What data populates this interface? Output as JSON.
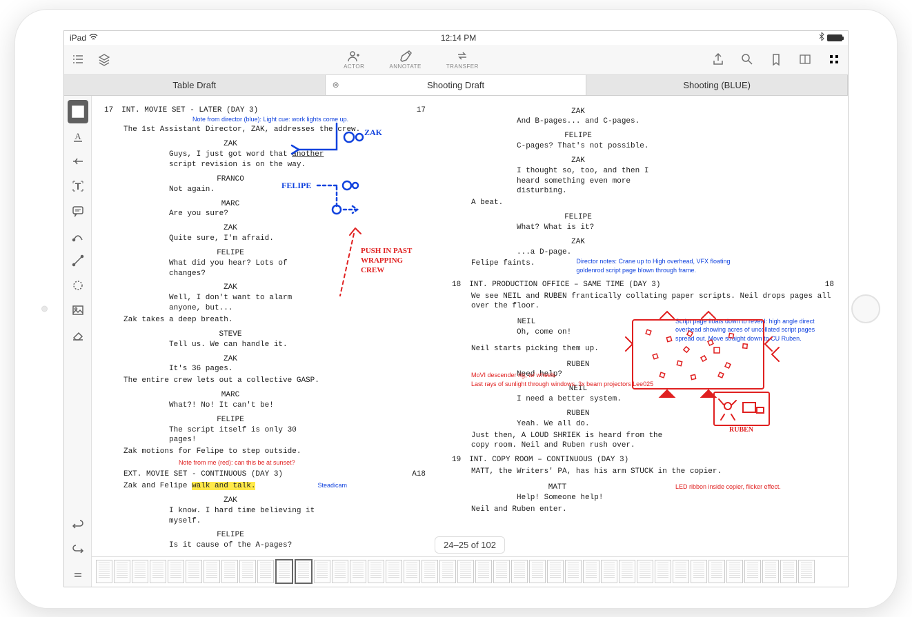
{
  "statusBar": {
    "device": "iPad",
    "time": "12:14 PM"
  },
  "toolbar": {
    "center": {
      "actor": "ACTOR",
      "annotate": "ANNOTATE",
      "transfer": "TRANSFER"
    }
  },
  "tabs": [
    {
      "label": "Table Draft",
      "active": false
    },
    {
      "label": "Shooting Draft",
      "active": true,
      "closable": true
    },
    {
      "label": "Shooting (BLUE)",
      "active": false
    }
  ],
  "pageIndicator": "24–25 of 102",
  "leftPage": {
    "sceneNum": "17",
    "sceneNumRight": "17",
    "sceneARight": "A18",
    "slug1": "INT. MOVIE SET - LATER (DAY 3)",
    "noteBlue1": "Note from director (blue): Light cue: work lights come up.",
    "action1": "The 1st Assistant Director, ZAK, addresses the crew.",
    "char1": "ZAK",
    "d1a": "Guys, I just got word that ",
    "d1u": "another",
    "d1b": "script revision is on the way.",
    "char2": "FRANCO",
    "d2": "Not again.",
    "char3": "MARC",
    "d3": "Are you sure?",
    "char4": "ZAK",
    "d4": "Quite sure, I'm afraid.",
    "char5": "FELIPE",
    "d5": "What did you hear? Lots of changes?",
    "char6": "ZAK",
    "d6": "Well, I don't want to alarm anyone, but...",
    "action2": "Zak takes a deep breath.",
    "char7": "STEVE",
    "d7": "Tell us. We can handle it.",
    "char8": "ZAK",
    "d8": "It's 36 pages.",
    "action3": "The entire crew lets out a collective GASP.",
    "char9": "MARC",
    "d9": "What?! No! It can't be!",
    "char10": "FELIPE",
    "d10": "The script itself is only 30 pages!",
    "action4": "Zak motions for Felipe to step outside.",
    "noteRed1": "Note from me (red): can this be at sunset?",
    "slug2": "EXT. MOVIE SET - CONTINUOUS (DAY 3)",
    "action5a": "Zak and Felipe ",
    "action5h": "walk and talk.",
    "noteBlue2": "Steadicam",
    "char11": "ZAK",
    "d11": "I know. I hard time believing it myself.",
    "char12": "FELIPE",
    "d12": "Is it cause of the A-pages?",
    "handZak": "ZAK",
    "handFelipe": "FELIPE",
    "handPush": "PUSH IN PAST WRAPPING CREW"
  },
  "rightPage": {
    "char1": "ZAK",
    "d1": "And B-pages... and C-pages.",
    "char2": "FELIPE",
    "d2": "C-pages? That's not possible.",
    "char3": "ZAK",
    "d3": "I thought so, too, and then I heard something even more disturbing.",
    "action1": "A beat.",
    "char4": "FELIPE",
    "d4": "What? What is it?",
    "char5": "ZAK",
    "d5": "...a D-page.",
    "action2": "Felipe faints.",
    "noteBlue1": "Director notes: Crane up to High overhead, VFX floating goldenrod script page blown through frame.",
    "scene18": "18",
    "scene18r": "18",
    "slug18": "INT. PRODUCTION OFFICE – SAME TIME (DAY 3)",
    "action3": "We see NEIL and RUBEN frantically collating paper scripts. Neil drops pages all over the floor.",
    "char6": "NEIL",
    "d6": "Oh, come on!",
    "noteBlue2": "Script page floats down to reveal: high angle direct overhead showing acres of uncollated script pages spread out. Move straight down to CU Ruben.",
    "action4": "Neil starts picking them up.",
    "char7": "RUBEN",
    "d7": "Need help?",
    "noteRed1": "MoVI descender rig, w/ wheels",
    "noteRed2": "Last rays of sunlight through windows, 3x beam projectors Lee025",
    "char8": "NEIL",
    "d8": "I need a better system.",
    "char9": "RUBEN",
    "d9": "Yeah. We all do.",
    "action5": "Just then, A LOUD SHRIEK is heard from the copy room. Neil and Ruben rush over.",
    "scene19": "19",
    "slug19": "INT. COPY ROOM – CONTINUOUS (DAY 3)",
    "action6": "MATT, the Writers' PA, has his arm STUCK in the copier.",
    "char10": "MATT",
    "d10": "Help! Someone help!",
    "noteRed3": "LED ribbon inside copier, flicker effect.",
    "action7": "Neil and Ruben enter.",
    "handRuben": "RUBEN"
  }
}
